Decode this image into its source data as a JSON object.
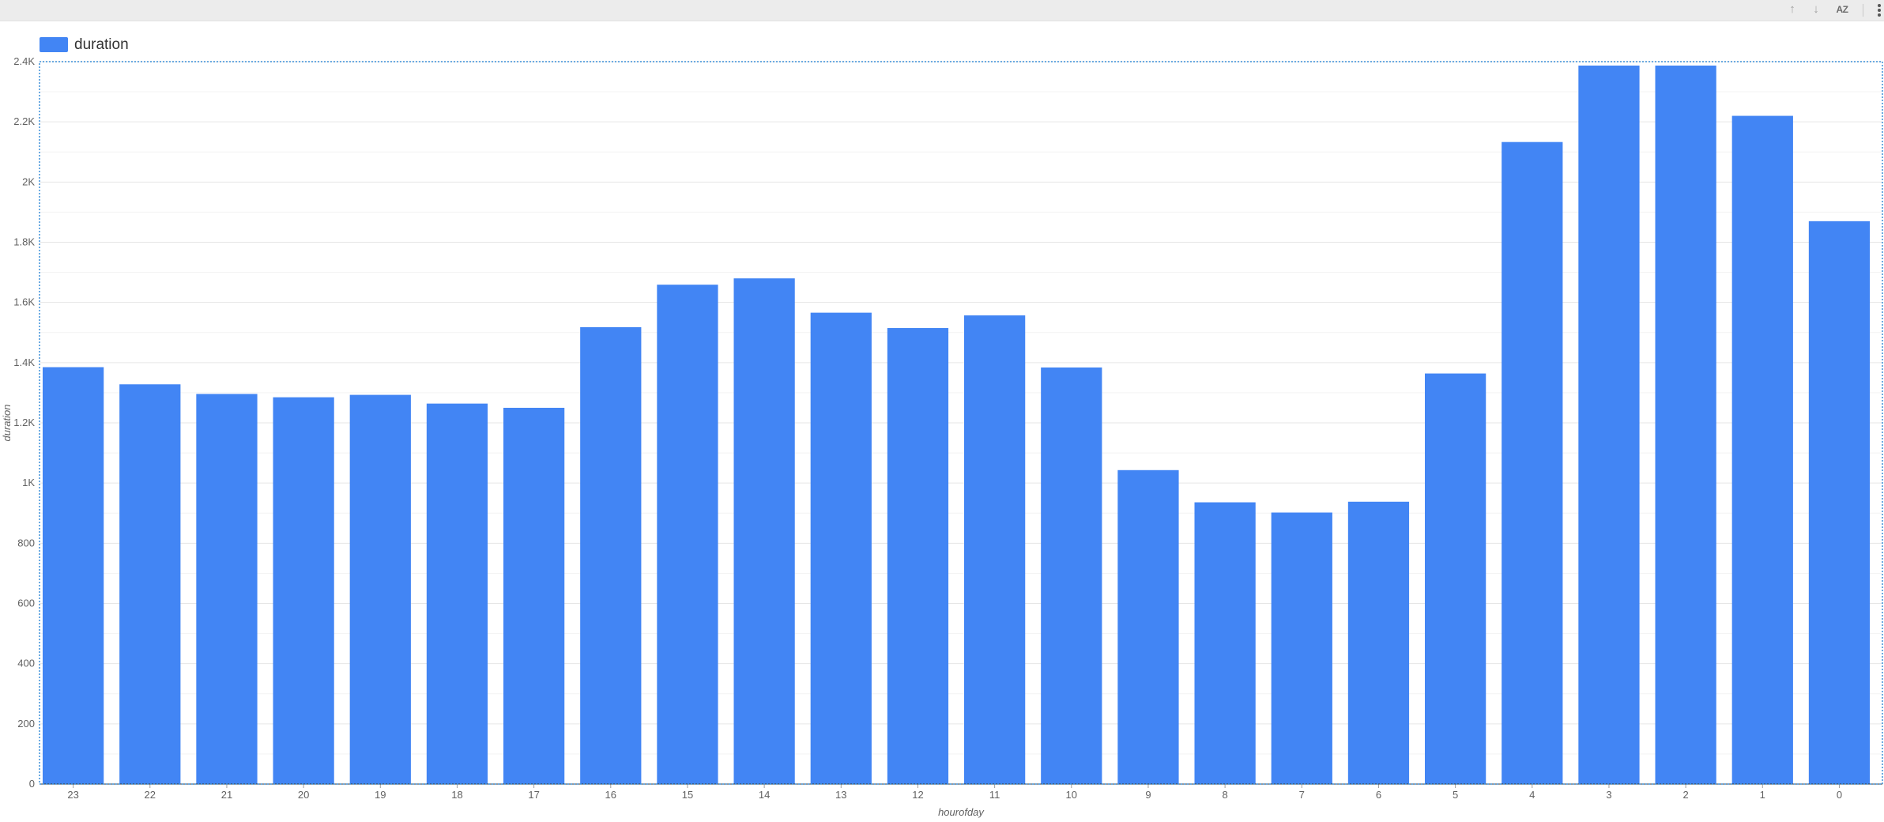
{
  "toolbar": {
    "icons": [
      "arrow-up-icon",
      "arrow-down-icon",
      "sort-az-icon",
      "more-vert-icon"
    ],
    "sort_az_label": "AZ"
  },
  "legend": {
    "label": "duration",
    "color": "#4285F4"
  },
  "chart_data": {
    "type": "bar",
    "title": "",
    "xlabel": "hourofday",
    "ylabel": "duration",
    "categories": [
      "23",
      "22",
      "21",
      "20",
      "19",
      "18",
      "17",
      "16",
      "15",
      "14",
      "13",
      "12",
      "11",
      "10",
      "9",
      "8",
      "7",
      "6",
      "5",
      "4",
      "3",
      "2",
      "1",
      "0"
    ],
    "series": [
      {
        "name": "duration",
        "color": "#4285F4",
        "values": [
          1385,
          1328,
          1296,
          1285,
          1293,
          1264,
          1250,
          1518,
          1659,
          1680,
          1566,
          1515,
          1557,
          1384,
          1043,
          936,
          902,
          938,
          1364,
          2133,
          2387,
          2387,
          2220,
          1870
        ]
      }
    ],
    "ylim": [
      0,
      2400
    ],
    "yticks": [
      0,
      200,
      400,
      600,
      800,
      1000,
      1200,
      1400,
      1600,
      1800,
      2000,
      2200,
      2400
    ],
    "ytick_labels": [
      "0",
      "200",
      "400",
      "600",
      "800",
      "1K",
      "1.2K",
      "1.4K",
      "1.6K",
      "1.8K",
      "2K",
      "2.2K",
      "2.4K"
    ],
    "grid": true,
    "legend_position": "top-left"
  }
}
